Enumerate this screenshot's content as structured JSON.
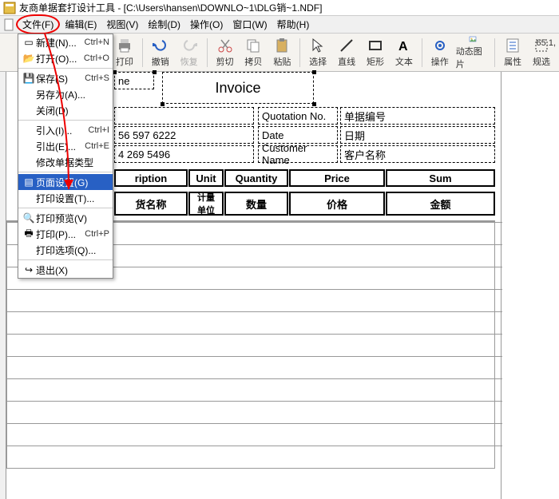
{
  "title": {
    "icon": "app-icon",
    "text": "友商单据套打设计工具 - [C:\\Users\\hansen\\DOWNLO~1\\DLG销~1.NDF]"
  },
  "menubar": [
    "文件(F)",
    "编辑(E)",
    "视图(V)",
    "绘制(D)",
    "操作(O)",
    "窗口(W)",
    "帮助(H)"
  ],
  "toolbar": [
    {
      "name": "print",
      "label": "打印"
    },
    {
      "name": "undo",
      "label": "撤销"
    },
    {
      "name": "redo",
      "label": "恢复",
      "disabled": true
    },
    {
      "name": "cut",
      "label": "剪切"
    },
    {
      "name": "copy",
      "label": "拷贝"
    },
    {
      "name": "paste",
      "label": "粘贴"
    },
    {
      "name": "select",
      "label": "选择"
    },
    {
      "name": "line",
      "label": "直线"
    },
    {
      "name": "rect",
      "label": "矩形"
    },
    {
      "name": "text",
      "label": "文本"
    },
    {
      "name": "action",
      "label": "操作"
    },
    {
      "name": "dynimg",
      "label": "动态图片"
    },
    {
      "name": "attr",
      "label": "属性"
    },
    {
      "name": "sel2",
      "label": "规选"
    }
  ],
  "status": "65.1,",
  "fileMenu": [
    {
      "txt": "新建(N)...",
      "shc": "Ctrl+N",
      "ic": "new"
    },
    {
      "txt": "打开(O)...",
      "shc": "Ctrl+O",
      "ic": "open"
    },
    {
      "sep": true
    },
    {
      "txt": "保存(S)",
      "shc": "Ctrl+S",
      "ic": "save"
    },
    {
      "txt": "另存为(A)...",
      "shc": ""
    },
    {
      "txt": "关闭(D)",
      "shc": ""
    },
    {
      "sep": true
    },
    {
      "txt": "引入(I)...",
      "shc": "Ctrl+I"
    },
    {
      "txt": "引出(E)...",
      "shc": "Ctrl+E"
    },
    {
      "txt": "修改单据类型",
      "shc": ""
    },
    {
      "sep": true
    },
    {
      "txt": "页面设置(G)",
      "shc": "",
      "hl": true,
      "ic": "pgset"
    },
    {
      "txt": "打印设置(T)...",
      "shc": ""
    },
    {
      "sep": true
    },
    {
      "txt": "打印预览(V)",
      "shc": "",
      "ic": "preview"
    },
    {
      "txt": "打印(P)...",
      "shc": "Ctrl+P",
      "ic": "print"
    },
    {
      "txt": "打印选项(Q)...",
      "shc": ""
    },
    {
      "sep": true
    },
    {
      "txt": "退出(X)",
      "shc": "",
      "ic": "exit"
    }
  ],
  "canvas": {
    "companySuffix": "ne",
    "invoice": "Invoice",
    "labels": {
      "quotNo": "Quotation No.",
      "quotNoZh": "单据编号",
      "date": "Date",
      "dateZh": "日期",
      "cust": "Customer Name",
      "custZh": "客户名称"
    },
    "phones": [
      "56 597 6222",
      "4 269 5496"
    ],
    "headersEn": [
      "ription",
      "Unit",
      "Quantity",
      "Price",
      "Sum"
    ],
    "headersZh": [
      "货名称",
      "计量单位",
      "数量",
      "价格",
      "金额"
    ]
  }
}
